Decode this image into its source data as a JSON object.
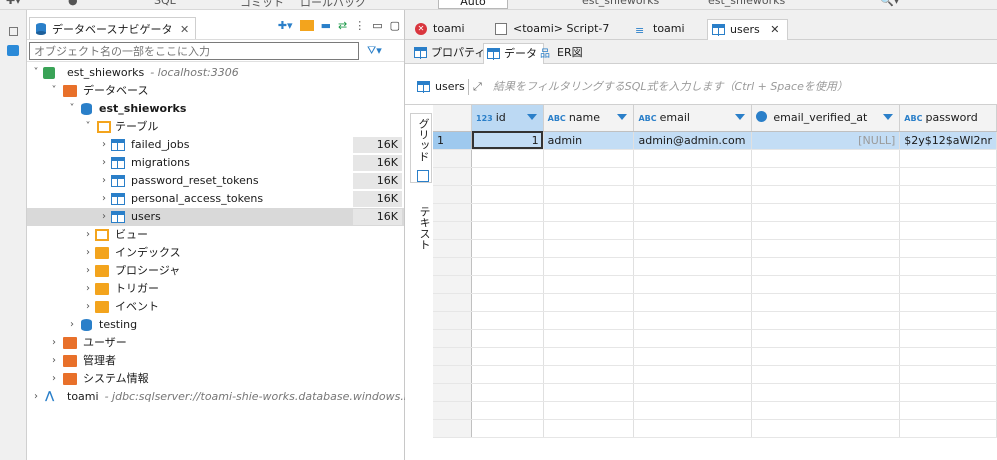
{
  "toolbar": {
    "sql_label": "SQL",
    "commit_label": "コミット",
    "rollback_label": "ロールバック",
    "auto_label": "Auto",
    "conn1_label": "est_shieworks",
    "conn2_label": "est_shieworks"
  },
  "navigator": {
    "tab_label": "データベースナビゲータ",
    "filter_placeholder": "オブジェクト名の一部をここに入力",
    "tree": {
      "connection": "est_shieworks",
      "connection_host": "- localhost:3306",
      "databases": "データベース",
      "schema": "est_shieworks",
      "tables_folder": "テーブル",
      "tables": [
        {
          "name": "failed_jobs",
          "size": "16K"
        },
        {
          "name": "migrations",
          "size": "16K"
        },
        {
          "name": "password_reset_tokens",
          "size": "16K"
        },
        {
          "name": "personal_access_tokens",
          "size": "16K"
        },
        {
          "name": "users",
          "size": "16K"
        }
      ],
      "views": "ビュー",
      "indexes": "インデックス",
      "procedures": "プロシージャ",
      "triggers": "トリガー",
      "events": "イベント",
      "testing": "testing",
      "users_node": "ユーザー",
      "admin_node": "管理者",
      "sysinfo_node": "システム情報",
      "toami": "toami",
      "toami_url": "- jdbc:sqlserver://toami-shie-works.database.windows.ne"
    }
  },
  "editor": {
    "tabs": [
      "toami",
      "<toami> Script-7",
      "toami",
      "users"
    ],
    "subtabs": [
      "プロパティ",
      "データ",
      "ER図"
    ],
    "source_label": "users",
    "filter_placeholder": "結果をフィルタリングするSQL式を入力します（Ctrl + Spaceを使用）",
    "vtabs": [
      "グリッド",
      "テキスト"
    ],
    "grid": {
      "columns": [
        {
          "type": "123",
          "name": "id"
        },
        {
          "type": "ABC",
          "name": "name"
        },
        {
          "type": "ABC",
          "name": "email"
        },
        {
          "type": "clock",
          "name": "email_verified_at"
        },
        {
          "type": "ABC",
          "name": "password"
        }
      ],
      "rows": [
        {
          "rn": "1",
          "id": "1",
          "name": "admin",
          "email": "admin@admin.com",
          "email_verified_at": "[NULL]",
          "password": "$2y$12$aWl2nr"
        }
      ]
    }
  },
  "colors": {
    "accent": "#2a7fc9",
    "selected_row": "#c3ddf5",
    "folder": "#f3a41d"
  }
}
